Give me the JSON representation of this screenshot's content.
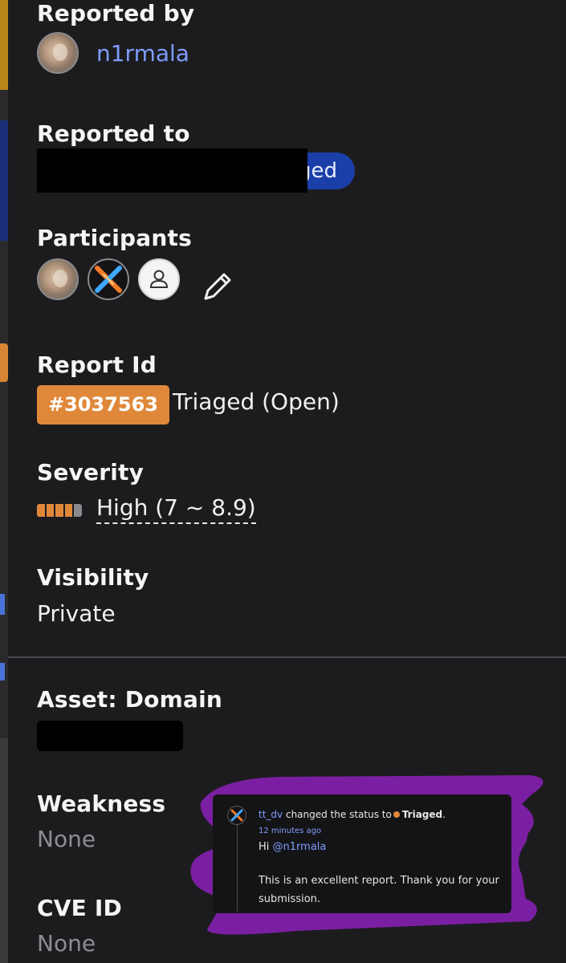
{
  "reported_by": {
    "label": "Reported by",
    "username": "n1rmala"
  },
  "reported_to": {
    "label": "Reported to",
    "pill_text_visible": "ged"
  },
  "participants": {
    "label": "Participants",
    "avatars": [
      "cat-avatar",
      "x-logo-avatar",
      "default-user-avatar"
    ]
  },
  "report": {
    "label": "Report Id",
    "id": "#3037563",
    "status": "Triaged (Open)"
  },
  "severity": {
    "label": "Severity",
    "text": "High (7 ~ 8.9)",
    "level": 4,
    "max": 5
  },
  "visibility": {
    "label": "Visibility",
    "value": "Private"
  },
  "asset": {
    "label": "Asset: Domain"
  },
  "weakness": {
    "label": "Weakness",
    "value": "None"
  },
  "cve": {
    "label": "CVE ID",
    "value": "None"
  },
  "comment": {
    "user": "tt_dv",
    "action": "changed the status to",
    "status": "Triaged",
    "period": ".",
    "time": "12 minutes ago",
    "greeting": "Hi",
    "mention": "@n1rmala",
    "body": "This is an excellent report. Thank you for your submission."
  },
  "colors": {
    "accent_orange": "#e0883a",
    "link_blue": "#7f9cff",
    "pill_blue": "#1b3fa8",
    "annotation_purple": "#7b1fa2",
    "background": "#1c1c1e"
  }
}
